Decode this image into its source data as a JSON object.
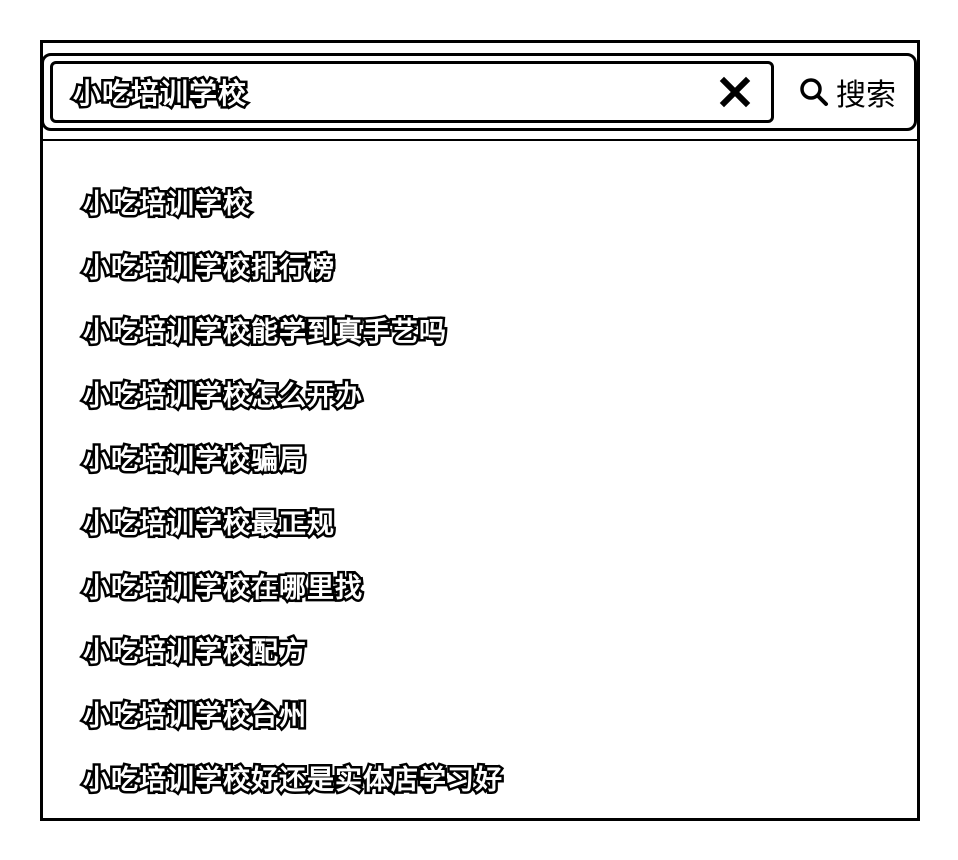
{
  "search": {
    "query": "小吃培训学校",
    "button_label": "搜索",
    "clear_icon": "close-icon",
    "search_icon": "magnifier-icon"
  },
  "suggestions": [
    {
      "text": "小吃培训学校"
    },
    {
      "text": "小吃培训学校排行榜"
    },
    {
      "text": "小吃培训学校能学到真手艺吗"
    },
    {
      "text": "小吃培训学校怎么开办"
    },
    {
      "text": "小吃培训学校骗局"
    },
    {
      "text": "小吃培训学校最正规"
    },
    {
      "text": "小吃培训学校在哪里找"
    },
    {
      "text": "小吃培训学校配方"
    },
    {
      "text": "小吃培训学校台州"
    },
    {
      "text": "小吃培训学校好还是实体店学习好"
    }
  ],
  "colors": {
    "border": "#000000",
    "background": "#ffffff",
    "text_fill": "#ffffff",
    "text_stroke": "#000000"
  }
}
